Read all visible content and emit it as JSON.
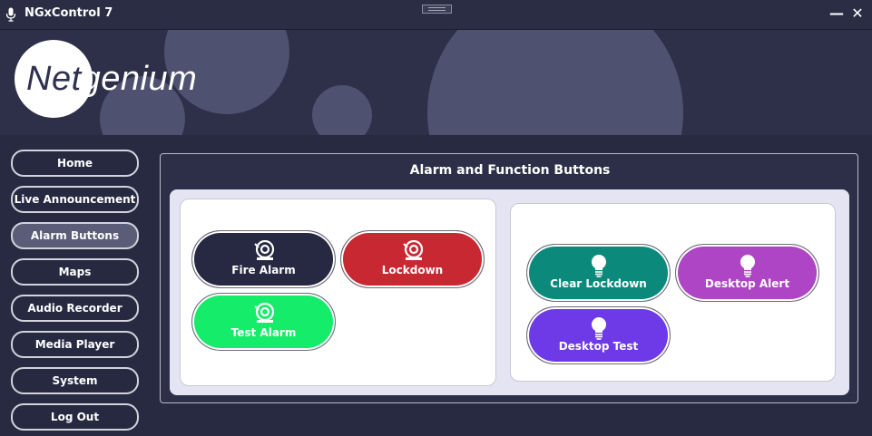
{
  "window": {
    "title": "NGxControl 7",
    "minimize_label": "—",
    "close_label": "✕",
    "icon": "microphone-icon"
  },
  "header": {
    "logo_part1": "Net",
    "logo_part2": "genium"
  },
  "sidebar": {
    "items": [
      {
        "label": "Home"
      },
      {
        "label": "Live Announcement"
      },
      {
        "label": "Alarm Buttons",
        "active": true
      },
      {
        "label": "Maps"
      },
      {
        "label": "Audio Recorder"
      },
      {
        "label": "Media Player"
      },
      {
        "label": "System"
      },
      {
        "label": "Log Out"
      }
    ]
  },
  "main": {
    "title": "Alarm and Function Buttons",
    "alarm_group": {
      "buttons": [
        {
          "label": "Fire Alarm",
          "icon": "bell-icon",
          "color": "#272842"
        },
        {
          "label": "Lockdown",
          "icon": "bell-icon",
          "color": "#c82832"
        },
        {
          "label": "Test Alarm",
          "icon": "bell-icon",
          "color": "#14ec6a"
        }
      ]
    },
    "function_group": {
      "buttons": [
        {
          "label": "Clear Lockdown",
          "icon": "lightbulb-icon",
          "color": "#0b8a7c"
        },
        {
          "label": "Desktop Alert",
          "icon": "lightbulb-icon",
          "color": "#ad45c5"
        },
        {
          "label": "Desktop Test",
          "icon": "lightbulb-icon",
          "color": "#6e3ae8"
        }
      ]
    }
  },
  "colors": {
    "background": "#272a40",
    "banner_bubble": "#4e5170",
    "panel_inner": "#e5e4f3",
    "nav_active": "#5a5c78"
  }
}
